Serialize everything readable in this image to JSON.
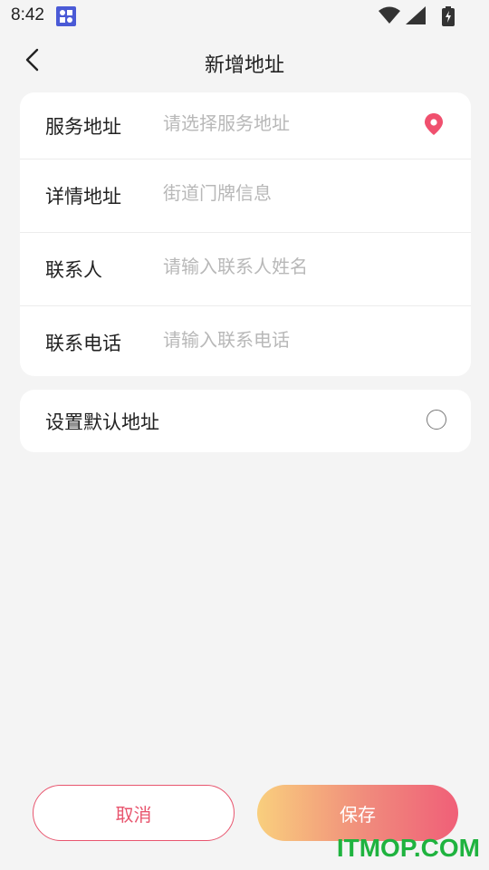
{
  "status_bar": {
    "time": "8:42",
    "icons": [
      "app-grid-icon",
      "wifi-icon",
      "signal-icon",
      "battery-charging-icon"
    ]
  },
  "header": {
    "title": "新增地址",
    "back_icon": "chevron-left-icon"
  },
  "form": {
    "rows": [
      {
        "label": "服务地址",
        "placeholder": "请选择服务地址",
        "value": "",
        "trailing_icon": "location-pin-icon"
      },
      {
        "label": "详情地址",
        "placeholder": "街道门牌信息",
        "value": ""
      },
      {
        "label": "联系人",
        "placeholder": "请输入联系人姓名",
        "value": ""
      },
      {
        "label": "联系电话",
        "placeholder": "请输入联系电话",
        "value": ""
      }
    ]
  },
  "default_address": {
    "label": "设置默认地址",
    "checked": false
  },
  "actions": {
    "cancel_label": "取消",
    "save_label": "保存"
  },
  "watermark": {
    "text": "ITMOP.COM"
  },
  "colors": {
    "accent": "#e8556e",
    "background": "#f4f4f4",
    "save_gradient_start": "#f9cf7d",
    "save_gradient_end": "#f05f78",
    "location_pin": "#f0506e",
    "watermark": "#1fb33f"
  }
}
